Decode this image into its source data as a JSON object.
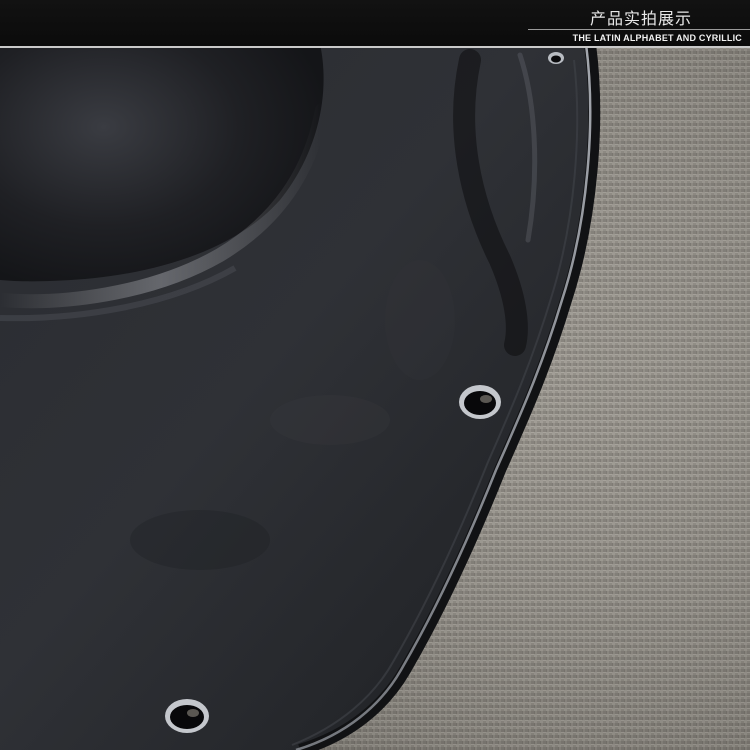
{
  "banner": {
    "title": "产品实拍展示",
    "subtitle": "THE LATIN ALPHABET AND CYRILLIC"
  },
  "photo": {
    "subject": "black-plastic-windshield-panel-icon",
    "background": "gray-fabric-texture-icon",
    "colors": {
      "panel": "#26282c",
      "fabric": "#8e8a82",
      "banner": "#0d0d0d"
    }
  }
}
